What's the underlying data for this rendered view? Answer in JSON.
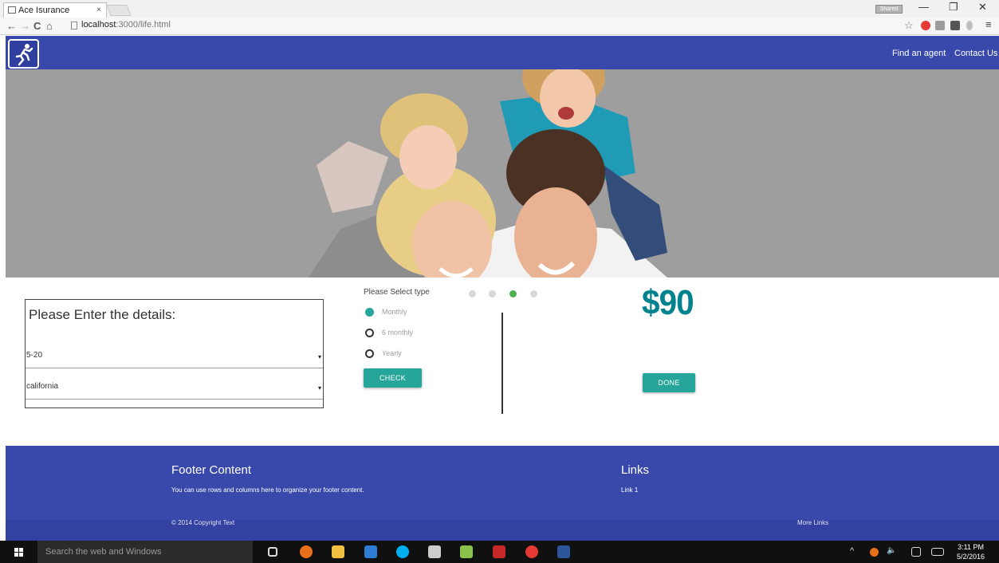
{
  "browser": {
    "tab_title": "Ace Isurance",
    "tab_close": "×",
    "profile_label": "Shared",
    "window_controls": {
      "minimize": "—",
      "maximize": "❐",
      "close": "✕"
    },
    "nav": {
      "back": "←",
      "forward": "→",
      "reload": "C",
      "home": "⌂"
    },
    "url_host": "localhost",
    "url_path": ":3000/life.html",
    "toolbar_icons": [
      "star-icon",
      "adblock-icon",
      "puzzle-icon",
      "cast-icon",
      "java-icon",
      "menu-icon"
    ]
  },
  "navbar": {
    "links": [
      "Find an agent",
      "Contact Us"
    ],
    "logo_icon": "runner-icon"
  },
  "form": {
    "title": "Please Enter the details:",
    "age_select": "5-20",
    "state_select": "california",
    "caret": "▾"
  },
  "payment": {
    "label": "Please Select type",
    "options": [
      "Monthly",
      "6 monthly",
      "Yearly"
    ],
    "selected": "Monthly",
    "check_button": "CHECK"
  },
  "carousel": {
    "count": 4,
    "active_index": 2,
    "active_color": "#4caf50"
  },
  "result": {
    "price": "$90",
    "done_button": "DONE"
  },
  "footer": {
    "title": "Footer Content",
    "text": "You can use rows and columns here to organize your footer content.",
    "links_title": "Links",
    "link1": "Link 1",
    "copyright": "© 2014 Copyright Text",
    "more_links": "More Links"
  },
  "taskbar": {
    "search_placeholder": "Search the web and Windows",
    "time": "3:11 PM",
    "date": "5/2/2016",
    "tray_up": "^",
    "tray_volume": "🔈"
  },
  "colors": {
    "primary": "#3949ab",
    "accent": "#26a69a",
    "price": "#00838f"
  }
}
